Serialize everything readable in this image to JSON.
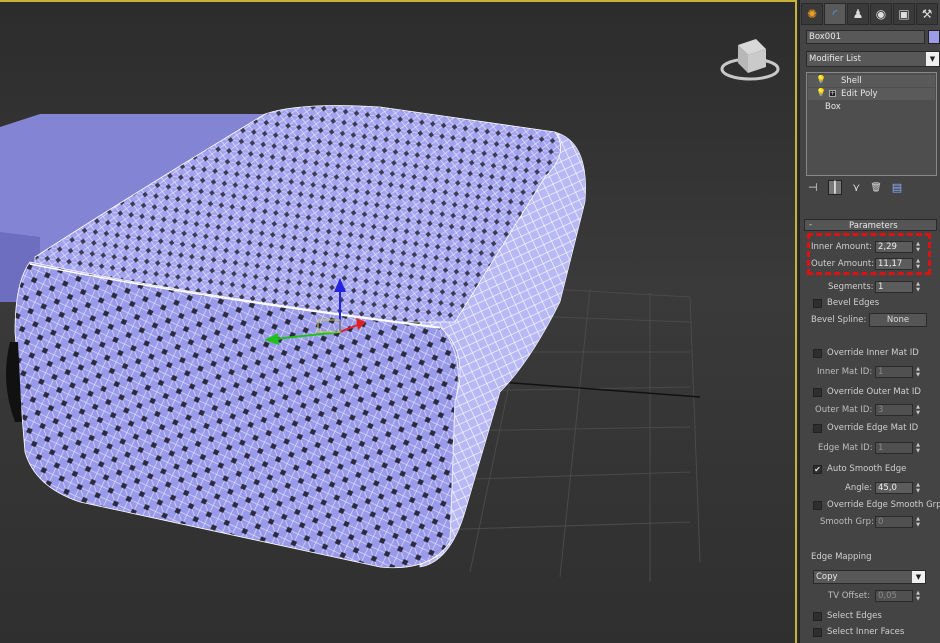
{
  "command_panel": {
    "tabs": [
      {
        "name": "create-tab",
        "icon": "sun-icon",
        "glyph": "✺"
      },
      {
        "name": "modify-tab",
        "icon": "modify-arc-icon",
        "glyph": "◜"
      },
      {
        "name": "hierarchy-tab",
        "icon": "hierarchy-icon",
        "glyph": "♟"
      },
      {
        "name": "motion-tab",
        "icon": "motion-icon",
        "glyph": "◉"
      },
      {
        "name": "display-tab",
        "icon": "display-monitor-icon",
        "glyph": "▣"
      },
      {
        "name": "utilities-tab",
        "icon": "hammer-icon",
        "glyph": "⚒"
      }
    ],
    "object_name": "Box001",
    "object_color": "#9c9ce6",
    "modifier_list_label": "Modifier List",
    "stack": [
      {
        "label": "Shell",
        "bulb": true,
        "box": false,
        "selected": false
      },
      {
        "label": "Edit Poly",
        "bulb": true,
        "box": true,
        "selected": false
      },
      {
        "label": "Box",
        "bulb": false,
        "box": false,
        "selected": false
      }
    ],
    "stack_tools": [
      {
        "name": "pin-stack-icon",
        "glyph": "⊣"
      },
      {
        "name": "show-end-result-icon",
        "glyph": "┃"
      },
      {
        "name": "make-unique-icon",
        "glyph": "⋎"
      },
      {
        "name": "remove-modifier-icon",
        "glyph": "🗑"
      },
      {
        "name": "configure-modifier-sets-icon",
        "glyph": "▤"
      }
    ]
  },
  "parameters": {
    "rollout_title": "Parameters",
    "collapse_symbol": "-",
    "inner_amount_label": "Inner Amount:",
    "inner_amount": "2,29",
    "outer_amount_label": "Outer Amount:",
    "outer_amount": "11,17",
    "segments_label": "Segments:",
    "segments": "1",
    "bevel_edges_label": "Bevel Edges",
    "bevel_spline_label": "Bevel Spline:",
    "bevel_spline_value": "None",
    "override_inner_label": "Override Inner Mat ID",
    "inner_mat_label": "Inner Mat ID:",
    "inner_mat": "1",
    "override_outer_label": "Override Outer Mat ID",
    "outer_mat_label": "Outer Mat ID:",
    "outer_mat": "3",
    "override_edge_label": "Override Edge Mat ID",
    "edge_mat_label": "Edge Mat ID:",
    "edge_mat": "1",
    "auto_smooth_label": "Auto Smooth Edge",
    "auto_smooth_checked": true,
    "angle_label": "Angle:",
    "angle": "45,0",
    "override_smooth_label": "Override Edge Smooth Grp",
    "smooth_grp_label": "Smooth Grp:",
    "smooth_grp": "0",
    "edge_mapping_label": "Edge Mapping",
    "edge_mapping_value": "Copy",
    "tv_offset_label": "TV Offset:",
    "tv_offset": "0,05",
    "select_edges_label": "Select Edges",
    "select_inner_label": "Select Inner Faces"
  },
  "viewport": {
    "highlight_color": "#e01010",
    "mesh_color": "#a0a0f0",
    "wire_color": "#ffffff",
    "axis_x_color": "#e02020",
    "axis_y_color": "#20c020",
    "axis_z_color": "#2020e0"
  }
}
